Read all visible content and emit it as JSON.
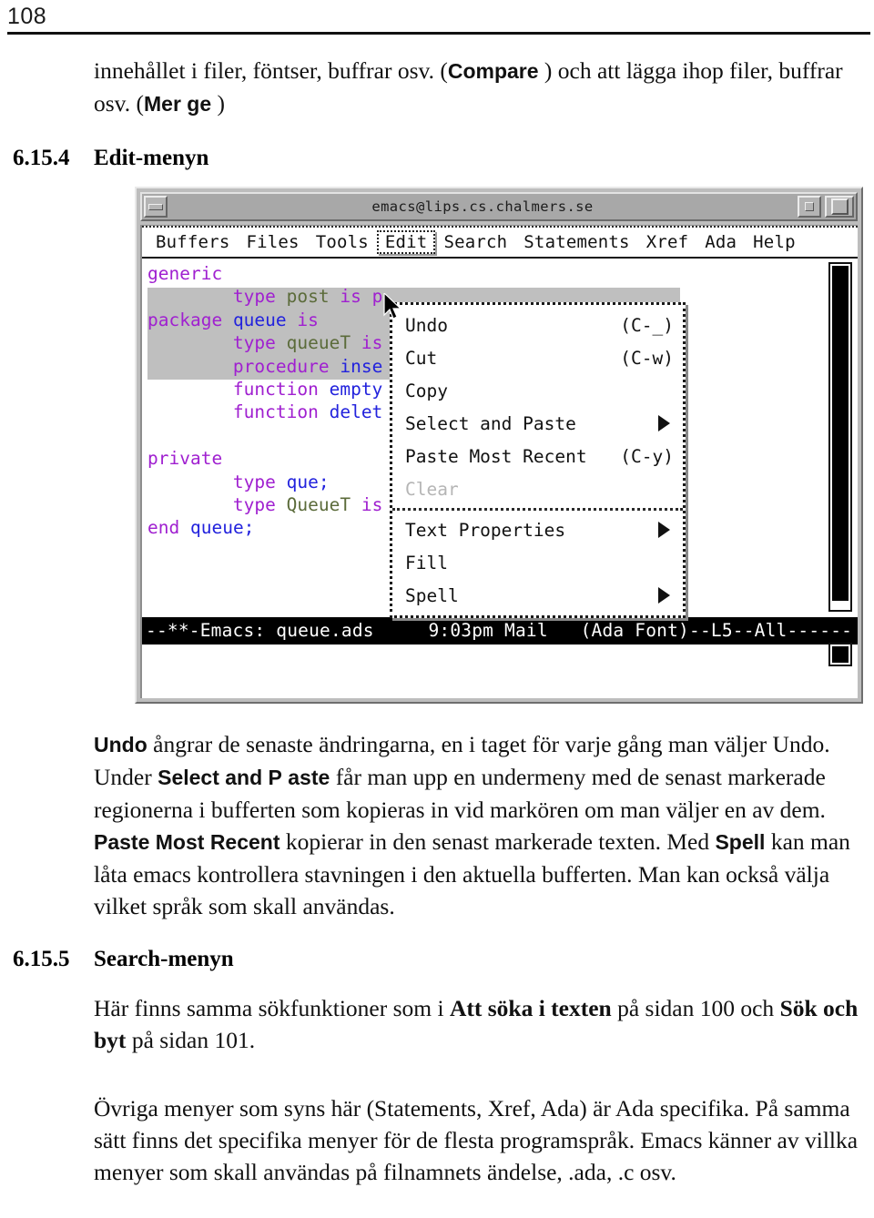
{
  "page": {
    "number": "108"
  },
  "intro_paragraph": {
    "part1": "innehållet i filer, föntser, buffrar osv. (",
    "bold1": "Compare",
    "part2": " ) och att lägga ihop filer, buffrar osv. (",
    "bold2": "Mer ge",
    "part3": " )"
  },
  "section_edit": {
    "number": "6.15.4",
    "title": "Edit-menyn"
  },
  "emacs": {
    "titlebar": {
      "title": "emacs@lips.cs.chalmers.se",
      "minimize_icon": "minimize-icon",
      "maximize_icon": "maximize-icon",
      "restore_icon": "restore-icon"
    },
    "menubar": [
      {
        "label": "Buffers",
        "active": false
      },
      {
        "label": "Files",
        "active": false
      },
      {
        "label": "Tools",
        "active": false
      },
      {
        "label": "Edit",
        "active": true
      },
      {
        "label": "Search",
        "active": false
      },
      {
        "label": "Statements",
        "active": false
      },
      {
        "label": "Xref",
        "active": false
      },
      {
        "label": "Ada",
        "active": false
      },
      {
        "label": "Help",
        "active": false
      }
    ],
    "buffer_lines": [
      "generic",
      "        type post is p",
      "package queue is",
      "        type queueT is",
      "        procedure inse",
      "        function empty",
      "        function delet",
      "",
      "private",
      "        type que;",
      "        type QueueT is",
      "end queue;"
    ],
    "modeline": "--**-Emacs: queue.ads     9:03pm Mail   (Ada Font)--L5--All------",
    "edit_menu": [
      {
        "label": "Undo",
        "key": "(C-_)",
        "submenu": false,
        "disabled": false
      },
      {
        "label": "Cut",
        "key": "(C-w)",
        "submenu": false,
        "disabled": false
      },
      {
        "label": "Copy",
        "key": "",
        "submenu": false,
        "disabled": false
      },
      {
        "label": "Select and Paste",
        "key": "",
        "submenu": true,
        "disabled": false
      },
      {
        "label": "Paste Most Recent",
        "key": "(C-y)",
        "submenu": false,
        "disabled": false
      },
      {
        "label": "Clear",
        "key": "",
        "submenu": false,
        "disabled": true
      },
      {
        "label": "Text Properties",
        "key": "",
        "submenu": true,
        "disabled": false
      },
      {
        "label": "Fill",
        "key": "",
        "submenu": false,
        "disabled": false
      },
      {
        "label": "Spell",
        "key": "",
        "submenu": true,
        "disabled": false
      }
    ]
  },
  "edit_description": {
    "b1": "Undo",
    "t1": " ångrar de senaste ändringarna, en i taget för varje gång man väljer Undo. Under ",
    "b2": "Select and P",
    "t2": " ",
    "b3": "aste",
    "t3": " får man upp en undermeny med de senast markerade regionerna i bufferten som kopieras in vid markören om man väljer en av dem. ",
    "b4": "Paste Most Recent",
    "t4": " kopierar in den senast markerade texten. Med ",
    "b5": "Spell",
    "t5": " kan man låta emacs kontrollera stavningen i den aktuella bufferten. Man kan också välja vilket språk som skall användas."
  },
  "section_search": {
    "number": "6.15.5",
    "title": "Search-menyn"
  },
  "search_description": {
    "t1": "Här finns samma sökfunktioner som i ",
    "b1": "Att söka i texten",
    "t2": " på sidan 100 och ",
    "b2": "Sök och byt",
    "t3": " på sidan 101."
  },
  "closing_paragraph": {
    "text": "Övriga menyer som syns här (Statements, Xref, Ada) är Ada specifika. På samma sätt finns det specifika menyer för de flesta programspråk. Emacs känner av villka menyer som skall användas på filnamnets ändelse, .ada, .c osv."
  },
  "colors": {
    "keyword": "#a020d0",
    "identifier": "#2222dd",
    "type": "#5b6b3a",
    "region_highlight": "#bfbfbf",
    "modeline_bg": "#000000",
    "frame_bg": "#bdbdbd"
  }
}
